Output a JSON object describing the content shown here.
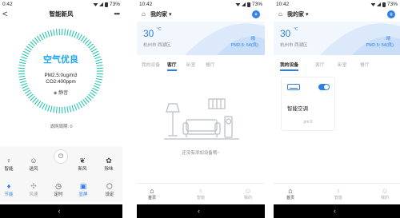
{
  "screen1": {
    "status_time": "0:42",
    "battery": "73%",
    "title": "智能新风",
    "back": "<",
    "more": "•••",
    "air_quality": "空气优良",
    "pm": "PM2.5:0ug/m3",
    "co2": "CO2:400ppm",
    "mode": "静音",
    "filter": "滤网周期: 0",
    "controls_row1": [
      "智能",
      "送风",
      "新风",
      "除味"
    ],
    "controls_row2": [
      "节能",
      "风速",
      "定时",
      "显屏",
      "设定"
    ]
  },
  "screen2": {
    "status_time": "10:42",
    "battery": "73%",
    "home_name": "我的家",
    "temp": "30",
    "unit": "°C",
    "location": "杭州市 西湖区",
    "condition": "晴",
    "pm": "PM2.5: 54(良)",
    "tabs": [
      "我的设备",
      "客厅",
      "卧室",
      "餐厅"
    ],
    "active_tab": 1,
    "empty_text": "还没有添加设备哦~",
    "bottom": [
      "首页",
      "智能",
      "我的"
    ]
  },
  "screen3": {
    "status_time": "10:42",
    "battery": "73%",
    "home_name": "我的家",
    "temp": "30",
    "unit": "°C",
    "location": "杭州市 西湖区",
    "condition": "晴",
    "pm": "PM2.5: 54(良)",
    "tabs": [
      "我的设备",
      "客厅",
      "卧室",
      "餐厅"
    ],
    "active_tab": 0,
    "device_name": "智能空调",
    "device_pm": "pm:0",
    "device_on": true,
    "bottom": [
      "首页",
      "智能",
      "我的"
    ]
  },
  "colors": {
    "accent": "#2f7ee6",
    "dial": "#24c5b0",
    "air": "#23a8e8"
  }
}
